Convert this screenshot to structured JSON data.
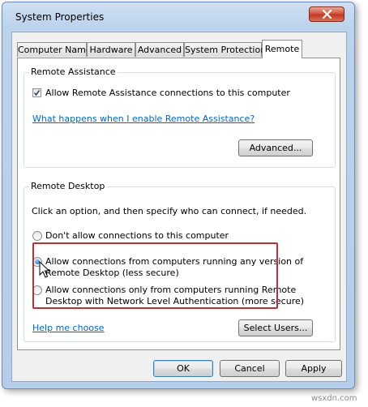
{
  "window": {
    "title": "System Properties"
  },
  "tabs": [
    {
      "label": "Computer Name",
      "active": false
    },
    {
      "label": "Hardware",
      "active": false
    },
    {
      "label": "Advanced",
      "active": false
    },
    {
      "label": "System Protection",
      "active": false
    },
    {
      "label": "Remote",
      "active": true
    }
  ],
  "remote_assistance": {
    "group_label": "Remote Assistance",
    "allow_checkbox_label": "Allow Remote Assistance connections to this computer",
    "allow_checked": true,
    "help_link": "What happens when I enable Remote Assistance?",
    "advanced_button": "Advanced..."
  },
  "remote_desktop": {
    "group_label": "Remote Desktop",
    "instructions": "Click an option, and then specify who can connect, if needed.",
    "options": [
      {
        "line1": "Don't allow connections to this computer",
        "line2": "",
        "checked": false
      },
      {
        "line1": "Allow connections from computers running any version of",
        "line2": "Remote Desktop (less secure)",
        "checked": true
      },
      {
        "line1": "Allow connections only from computers running Remote",
        "line2": "Desktop with Network Level Authentication (more secure)",
        "checked": false
      }
    ],
    "help_link": "Help me choose",
    "select_users_button": "Select Users..."
  },
  "footer": {
    "ok": "OK",
    "cancel": "Cancel",
    "apply": "Apply"
  },
  "watermark": "wsxdn.com",
  "colors": {
    "link": "#0066cc",
    "highlight_border": "#b8303a",
    "title_bar": "#bcd3ec"
  }
}
